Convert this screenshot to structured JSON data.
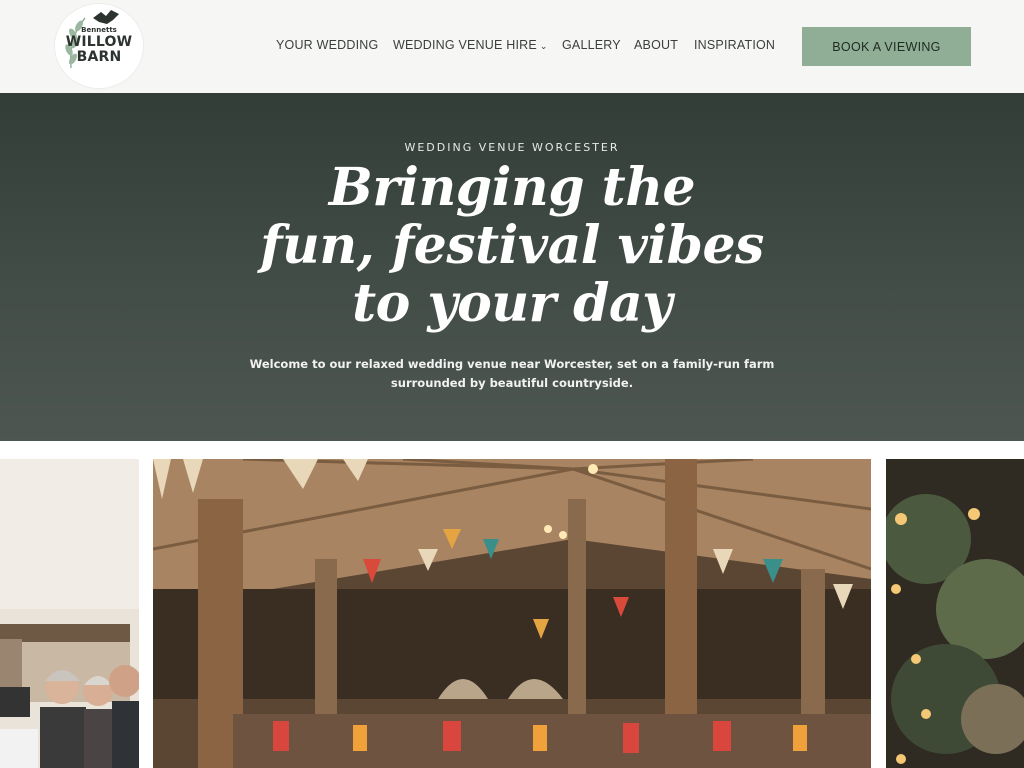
{
  "brand": {
    "logo_small": "Bennetts",
    "logo_line1": "WILLOW",
    "logo_line2": "BARN"
  },
  "nav": {
    "items": [
      {
        "label": "YOUR WEDDING"
      },
      {
        "label": "WEDDING VENUE HIRE",
        "icon": "chevron-down-icon"
      },
      {
        "label": "GALLERY"
      },
      {
        "label": "ABOUT"
      },
      {
        "label": "INSPIRATION"
      }
    ],
    "cta_label": "BOOK A VIEWING"
  },
  "hero": {
    "eyebrow": "WEDDING VENUE WORCESTER",
    "headline_lines": [
      "Bringing the",
      "fun, festival vibes",
      "to your day"
    ],
    "intro_line1": "Welcome to our relaxed wedding venue near Worcester, set on a family-run farm",
    "intro_line2": "surrounded by beautiful countryside."
  },
  "colors": {
    "header_bg": "#f6f6f5",
    "hero_bg": "#3b4540",
    "cta_bg": "#8fae95",
    "text_dark": "#3b3f3c"
  }
}
